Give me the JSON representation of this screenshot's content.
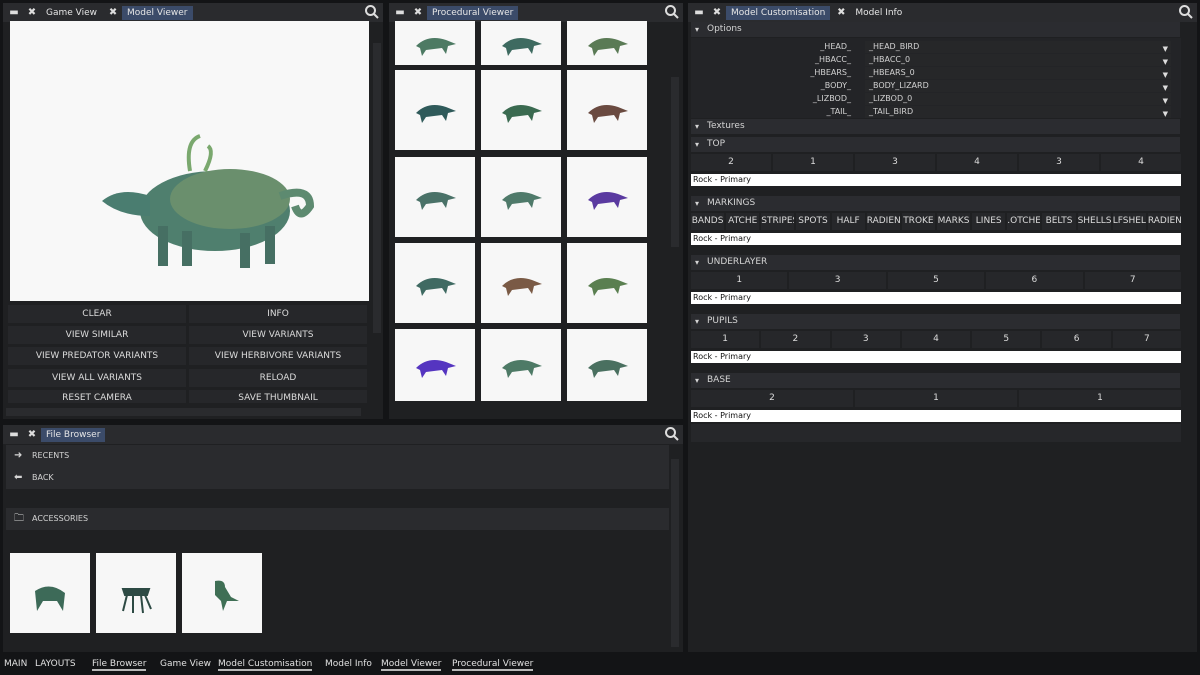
{
  "left_top_panel": {
    "tabs": [
      {
        "label": "Game View"
      },
      {
        "label": "Model Viewer"
      }
    ],
    "buttons": [
      [
        "CLEAR",
        "INFO"
      ],
      [
        "VIEW SIMILAR",
        "VIEW VARIANTS"
      ],
      [
        "VIEW PREDATOR VARIANTS",
        "VIEW HERBIVORE VARIANTS"
      ],
      [
        "VIEW ALL VARIANTS",
        "RELOAD"
      ],
      [
        "RESET CAMERA",
        "SAVE THUMBNAIL"
      ]
    ]
  },
  "procedural_panel": {
    "tabs": [
      {
        "label": "Procedural Viewer"
      }
    ],
    "thumbnails_count_note": "",
    "rows": 5
  },
  "customisation_panel": {
    "tabs": [
      {
        "label": "Model Customisation"
      },
      {
        "label": "Model Info"
      }
    ],
    "options_header": "Options",
    "options": [
      {
        "label": "_HEAD_",
        "value": "_HEAD_BIRD"
      },
      {
        "label": "_HBACC_",
        "value": "_HBACC_0"
      },
      {
        "label": "_HBEARS_",
        "value": "_HBEARS_0"
      },
      {
        "label": "_BODY_",
        "value": "_BODY_LIZARD"
      },
      {
        "label": "_LIZBOD_",
        "value": "_LIZBOD_0"
      },
      {
        "label": "_TAIL_",
        "value": "_TAIL_BIRD"
      }
    ],
    "textures_header": "Textures",
    "sections": [
      {
        "title": "TOP",
        "buttons": [
          "2",
          "1",
          "3",
          "4",
          "3",
          "4"
        ],
        "bar": "Rock - Primary"
      },
      {
        "title": "MARKINGS",
        "buttons": [
          "BANDS",
          "ATCHE",
          "STRIPES",
          "SPOTS",
          "HALF",
          "RADIEN",
          "TROKE",
          "MARKS",
          "LINES",
          ".OTCHE",
          "BELTS",
          "SHELLS",
          "LFSHEL",
          "RADIEN"
        ],
        "bar": "Rock - Primary"
      },
      {
        "title": "UNDERLAYER",
        "buttons": [
          "1",
          "3",
          "5",
          "6",
          "7"
        ],
        "bar": "Rock - Primary"
      },
      {
        "title": "PUPILS",
        "buttons": [
          "1",
          "2",
          "3",
          "4",
          "5",
          "6",
          "7"
        ],
        "bar": "Rock - Primary"
      },
      {
        "title": "BASE",
        "buttons": [
          "2",
          "1",
          "1"
        ],
        "bar": "Rock - Primary"
      }
    ]
  },
  "file_browser": {
    "tabs": [
      {
        "label": "File Browser"
      }
    ],
    "recents_label": "RECENTS",
    "back_label": "BACK",
    "folder_label": "ACCESSORIES"
  },
  "bottom_bar": {
    "items": [
      "MAIN",
      "LAYOUTS",
      "File Browser",
      "Game View",
      "Model Customisation",
      "Model Info",
      "Model Viewer",
      "Procedural Viewer"
    ]
  },
  "colors": {
    "accent": "#3b4b69",
    "panel": "#1f2022",
    "background": "#131416"
  }
}
